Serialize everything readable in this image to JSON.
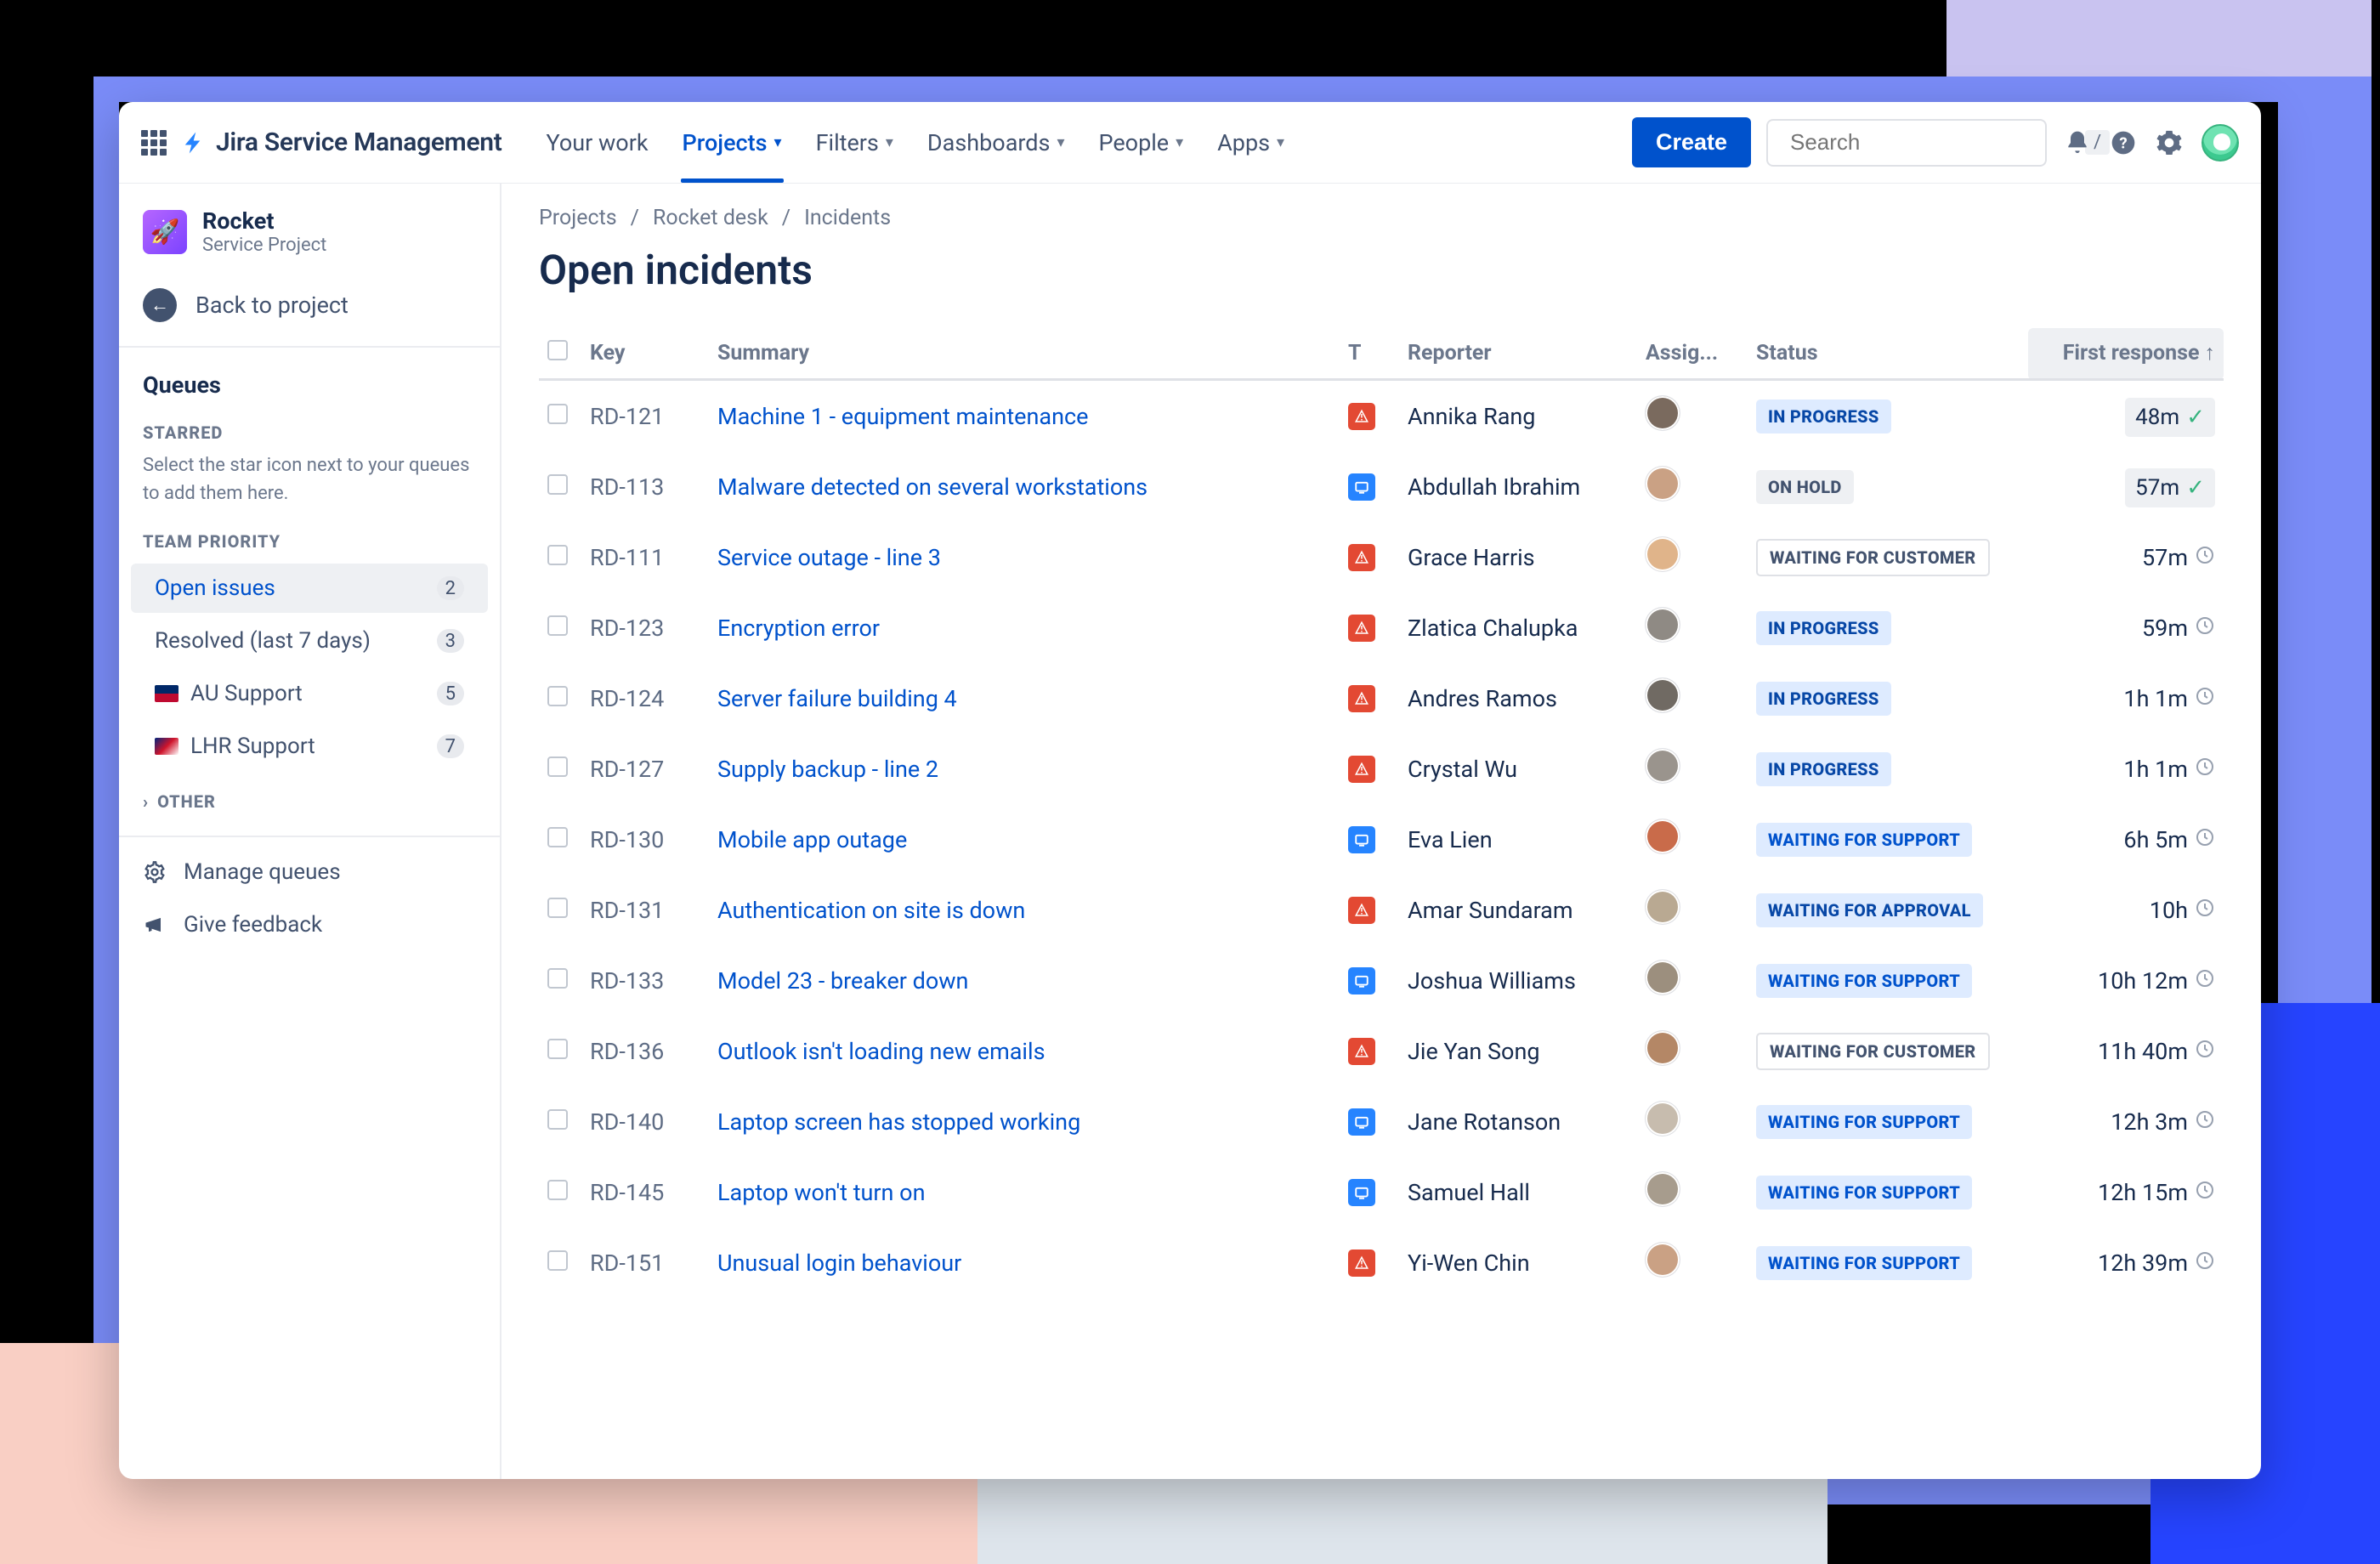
{
  "app_title": "Jira Service Management",
  "nav": {
    "your_work": "Your work",
    "projects": "Projects",
    "filters": "Filters",
    "dashboards": "Dashboards",
    "people": "People",
    "apps": "Apps",
    "create": "Create"
  },
  "search": {
    "placeholder": "Search",
    "shortcut": "/"
  },
  "sidebar": {
    "project_name": "Rocket",
    "project_sub": "Service Project",
    "back": "Back to project",
    "queues_heading": "Queues",
    "starred_heading": "STARRED",
    "starred_hint": "Select the star icon next to your queues to add them here.",
    "team_heading": "TEAM PRIORITY",
    "items": [
      {
        "label": "Open issues",
        "count": "2",
        "active": true
      },
      {
        "label": "Resolved (last 7 days)",
        "count": "3"
      },
      {
        "label": "AU Support",
        "count": "5",
        "flag": "au"
      },
      {
        "label": "LHR Support",
        "count": "7",
        "flag": "uk"
      }
    ],
    "other": "OTHER",
    "manage": "Manage queues",
    "feedback": "Give feedback"
  },
  "breadcrumb": {
    "a": "Projects",
    "b": "Rocket desk",
    "c": "Incidents"
  },
  "page_title": "Open incidents",
  "columns": {
    "key": "Key",
    "summary": "Summary",
    "t": "T",
    "reporter": "Reporter",
    "assignee": "Assig...",
    "status": "Status",
    "first_response": "First response"
  },
  "statuses": {
    "progress": "IN PROGRESS",
    "hold": "ON HOLD",
    "cust": "WAITING FOR CUSTOMER",
    "supp": "WAITING FOR SUPPORT",
    "appr": "WAITING FOR APPROVAL"
  },
  "rows": [
    {
      "key": "RD-121",
      "summary": "Machine 1 - equipment maintenance",
      "t": "red",
      "reporter": "Annika Rang",
      "status": "progress",
      "resp": "48m",
      "pill": true,
      "ok": true,
      "av": "#7a6a5e"
    },
    {
      "key": "RD-113",
      "summary": "Malware detected on several workstations",
      "t": "blue",
      "reporter": "Abdullah Ibrahim",
      "status": "hold",
      "resp": "57m",
      "pill": true,
      "ok": true,
      "av": "#caa184"
    },
    {
      "key": "RD-111",
      "summary": "Service outage - line 3",
      "t": "red",
      "reporter": "Grace Harris",
      "status": "cust",
      "resp": "57m",
      "av": "#e0b48a"
    },
    {
      "key": "RD-123",
      "summary": "Encryption error",
      "t": "red",
      "reporter": "Zlatica Chalupka",
      "status": "progress",
      "resp": "59m",
      "av": "#8f8a84"
    },
    {
      "key": "RD-124",
      "summary": "Server failure building 4",
      "t": "red",
      "reporter": "Andres Ramos",
      "status": "progress",
      "resp": "1h 1m",
      "av": "#706a63"
    },
    {
      "key": "RD-127",
      "summary": "Supply backup - line 2",
      "t": "red",
      "reporter": "Crystal Wu",
      "status": "progress",
      "resp": "1h 1m",
      "av": "#9a948d"
    },
    {
      "key": "RD-130",
      "summary": "Mobile app outage",
      "t": "blue",
      "reporter": "Eva Lien",
      "status": "supp",
      "resp": "6h 5m",
      "av": "#c96b4a"
    },
    {
      "key": "RD-131",
      "summary": "Authentication on site is down",
      "t": "red",
      "reporter": "Amar Sundaram",
      "status": "appr",
      "resp": "10h",
      "av": "#b9a992"
    },
    {
      "key": "RD-133",
      "summary": "Model 23 - breaker down",
      "t": "blue",
      "reporter": "Joshua Williams",
      "status": "supp",
      "resp": "10h 12m",
      "av": "#9c8f7e"
    },
    {
      "key": "RD-136",
      "summary": "Outlook isn't loading new emails",
      "t": "red",
      "reporter": "Jie Yan Song",
      "status": "cust",
      "resp": "11h 40m",
      "av": "#b48766"
    },
    {
      "key": "RD-140",
      "summary": "Laptop screen has stopped working",
      "t": "blue",
      "reporter": "Jane Rotanson",
      "status": "supp",
      "resp": "12h 3m",
      "av": "#c7bcae"
    },
    {
      "key": "RD-145",
      "summary": "Laptop won't turn on",
      "t": "blue",
      "reporter": "Samuel Hall",
      "status": "supp",
      "resp": "12h 15m",
      "av": "#a79c8d"
    },
    {
      "key": "RD-151",
      "summary": "Unusual login behaviour",
      "t": "red",
      "reporter": "Yi-Wen Chin",
      "status": "supp",
      "resp": "12h 39m",
      "av": "#caa184"
    }
  ]
}
